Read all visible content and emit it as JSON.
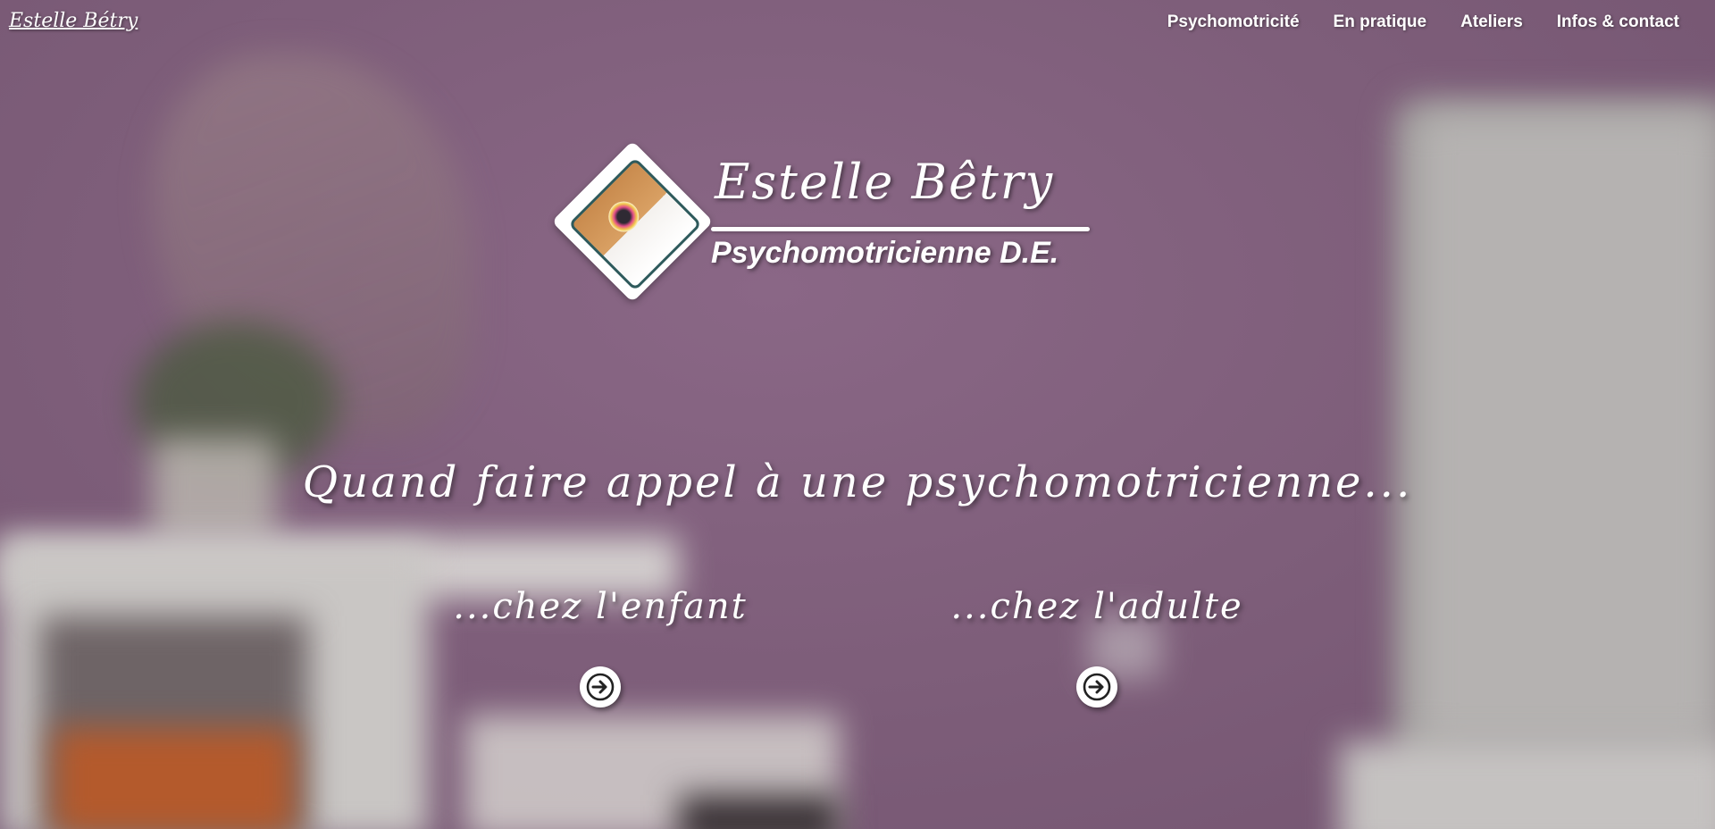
{
  "header": {
    "brand": "Estelle Bétry",
    "nav": [
      {
        "label": "Psychomotricité"
      },
      {
        "label": "En pratique"
      },
      {
        "label": "Ateliers"
      },
      {
        "label": "Infos & contact"
      }
    ]
  },
  "logo": {
    "name": "Estelle Bêtry",
    "title": "Psychomotricienne D.E."
  },
  "hero": {
    "headline": "Quand faire appel à une psychomotricienne...",
    "choices": [
      {
        "label": "...chez l'enfant",
        "icon": "arrow-right-circle-icon"
      },
      {
        "label": "...chez l'adulte",
        "icon": "arrow-right-circle-icon"
      }
    ]
  },
  "colors": {
    "wall": "#7f5f7c",
    "logo_border": "#2e5a5c",
    "text": "#ffffff"
  }
}
